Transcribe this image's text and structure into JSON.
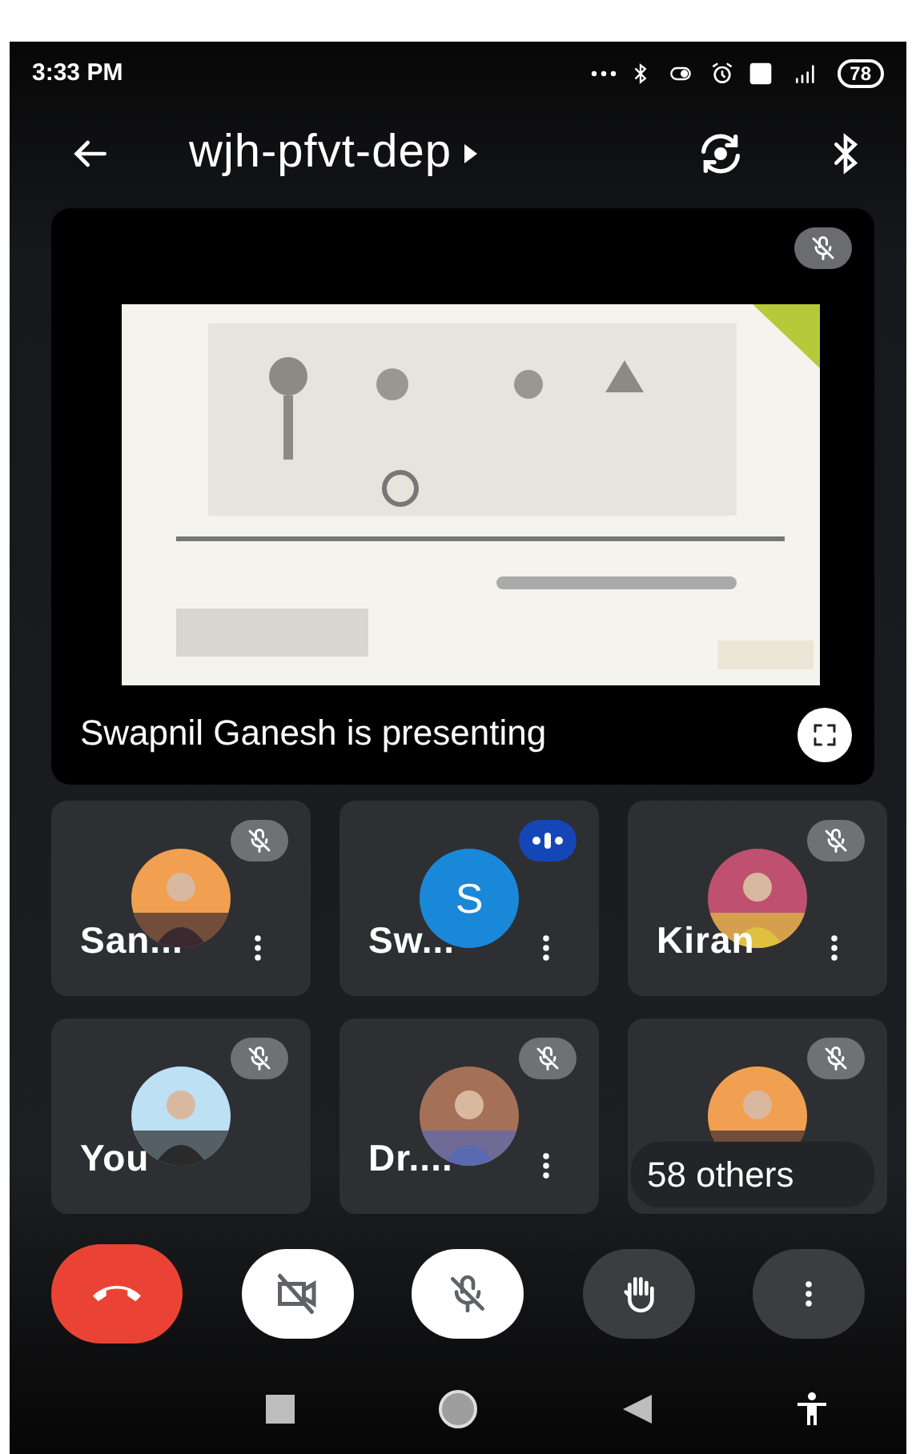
{
  "status_bar": {
    "time": "3:33 PM",
    "battery": "78"
  },
  "top_bar": {
    "title": "wjh-pfvt-dep"
  },
  "presentation": {
    "caption": "Swapnil Ganesh is presenting",
    "muted": true
  },
  "tiles": [
    {
      "name": "San...",
      "muted": true,
      "menu": true
    },
    {
      "name": "Sw...",
      "muted": false,
      "speaking": true,
      "kind": "letter",
      "letter": "S",
      "color": "#1a88d8",
      "menu": true
    },
    {
      "name": "Kiran",
      "muted": true,
      "menu": true
    },
    {
      "name": "You",
      "muted": true,
      "menu": false
    },
    {
      "name": "Dr....",
      "muted": true,
      "menu": true
    },
    {
      "muted": true,
      "menu": false,
      "others": "58 others"
    }
  ],
  "controls": [
    {
      "kind": "end"
    },
    {
      "kind": "camera",
      "on": false
    },
    {
      "kind": "mic",
      "on": false
    },
    {
      "kind": "hand"
    },
    {
      "kind": "more"
    }
  ]
}
